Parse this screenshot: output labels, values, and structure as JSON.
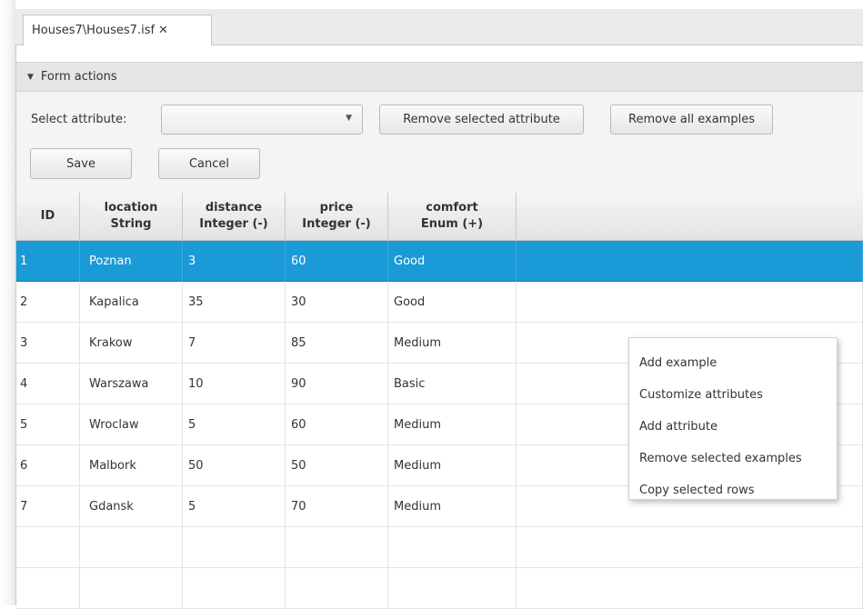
{
  "tab": {
    "label": "Houses7\\Houses7.isf",
    "close_glyph": "✕"
  },
  "form": {
    "header_label": "Form actions",
    "select_label": "Select attribute:",
    "select_value": "",
    "remove_attribute_label": "Remove selected attribute",
    "remove_examples_label": "Remove all examples",
    "save_label": "Save",
    "cancel_label": "Cancel"
  },
  "table": {
    "columns": [
      {
        "name": "ID",
        "type": ""
      },
      {
        "name": "location",
        "type": "String"
      },
      {
        "name": "distance",
        "type": "Integer (-)"
      },
      {
        "name": "price",
        "type": "Integer (-)"
      },
      {
        "name": "comfort",
        "type": "Enum (+)"
      }
    ],
    "rows": [
      [
        "1",
        "Poznan",
        "3",
        "60",
        "Good"
      ],
      [
        "2",
        "Kapalica",
        "35",
        "30",
        "Good"
      ],
      [
        "3",
        "Krakow",
        "7",
        "85",
        "Medium"
      ],
      [
        "4",
        "Warszawa",
        "10",
        "90",
        "Basic"
      ],
      [
        "5",
        "Wroclaw",
        "5",
        "60",
        "Medium"
      ],
      [
        "6",
        "Malbork",
        "50",
        "50",
        "Medium"
      ],
      [
        "7",
        "Gdansk",
        "5",
        "70",
        "Medium"
      ]
    ],
    "selected_row": 0
  },
  "context_menu": {
    "items": [
      "Add example",
      "Customize attributes",
      "Add attribute",
      "Remove selected examples",
      "Copy selected rows"
    ]
  },
  "colors": {
    "selection": "#1a9ad6",
    "header_bg": "#e5e5e5",
    "panel_bg": "#f4f4f4"
  }
}
